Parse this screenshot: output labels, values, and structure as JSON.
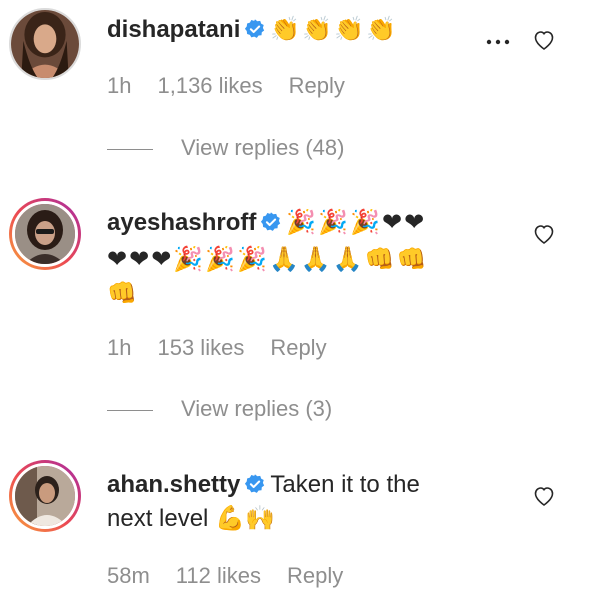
{
  "comments": [
    {
      "username": "dishapatani",
      "text": "👏👏👏👏",
      "time": "1h",
      "likes": "1,136 likes",
      "reply": "Reply",
      "view_replies": "View replies (48)",
      "verified": true,
      "story_ring": false
    },
    {
      "username": "ayeshashroff",
      "text_line1": "🎉🎉🎉❤❤",
      "text_line2": "❤❤❤🎉🎉🎉🙏🙏🙏👊👊",
      "text_line3": "👊",
      "time": "1h",
      "likes": "153 likes",
      "reply": "Reply",
      "view_replies": "View replies (3)",
      "verified": true,
      "story_ring": true
    },
    {
      "username": "ahan.shetty",
      "text_line1": "Taken it to the",
      "text_line2": "next level 💪🙌",
      "time": "58m",
      "likes": "112 likes",
      "reply": "Reply",
      "verified": true,
      "story_ring": true
    }
  ],
  "colors": {
    "text": "#262626",
    "meta": "#8e8e8e",
    "verified": "#3897f0",
    "ring_start": "#f9a53c",
    "ring_end": "#a02fb1"
  },
  "icons": {
    "verified": "verified-badge-icon",
    "like": "heart-outline-icon",
    "more": "more-options-icon"
  }
}
